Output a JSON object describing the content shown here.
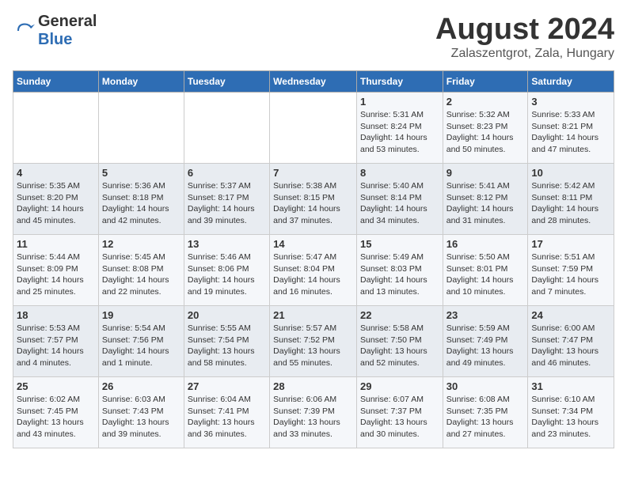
{
  "logo": {
    "line1": "General",
    "line2": "Blue"
  },
  "title": "August 2024",
  "subtitle": "Zalaszentgrot, Zala, Hungary",
  "days_of_week": [
    "Sunday",
    "Monday",
    "Tuesday",
    "Wednesday",
    "Thursday",
    "Friday",
    "Saturday"
  ],
  "weeks": [
    [
      {
        "day": "",
        "info": ""
      },
      {
        "day": "",
        "info": ""
      },
      {
        "day": "",
        "info": ""
      },
      {
        "day": "",
        "info": ""
      },
      {
        "day": "1",
        "info": "Sunrise: 5:31 AM\nSunset: 8:24 PM\nDaylight: 14 hours\nand 53 minutes."
      },
      {
        "day": "2",
        "info": "Sunrise: 5:32 AM\nSunset: 8:23 PM\nDaylight: 14 hours\nand 50 minutes."
      },
      {
        "day": "3",
        "info": "Sunrise: 5:33 AM\nSunset: 8:21 PM\nDaylight: 14 hours\nand 47 minutes."
      }
    ],
    [
      {
        "day": "4",
        "info": "Sunrise: 5:35 AM\nSunset: 8:20 PM\nDaylight: 14 hours\nand 45 minutes."
      },
      {
        "day": "5",
        "info": "Sunrise: 5:36 AM\nSunset: 8:18 PM\nDaylight: 14 hours\nand 42 minutes."
      },
      {
        "day": "6",
        "info": "Sunrise: 5:37 AM\nSunset: 8:17 PM\nDaylight: 14 hours\nand 39 minutes."
      },
      {
        "day": "7",
        "info": "Sunrise: 5:38 AM\nSunset: 8:15 PM\nDaylight: 14 hours\nand 37 minutes."
      },
      {
        "day": "8",
        "info": "Sunrise: 5:40 AM\nSunset: 8:14 PM\nDaylight: 14 hours\nand 34 minutes."
      },
      {
        "day": "9",
        "info": "Sunrise: 5:41 AM\nSunset: 8:12 PM\nDaylight: 14 hours\nand 31 minutes."
      },
      {
        "day": "10",
        "info": "Sunrise: 5:42 AM\nSunset: 8:11 PM\nDaylight: 14 hours\nand 28 minutes."
      }
    ],
    [
      {
        "day": "11",
        "info": "Sunrise: 5:44 AM\nSunset: 8:09 PM\nDaylight: 14 hours\nand 25 minutes."
      },
      {
        "day": "12",
        "info": "Sunrise: 5:45 AM\nSunset: 8:08 PM\nDaylight: 14 hours\nand 22 minutes."
      },
      {
        "day": "13",
        "info": "Sunrise: 5:46 AM\nSunset: 8:06 PM\nDaylight: 14 hours\nand 19 minutes."
      },
      {
        "day": "14",
        "info": "Sunrise: 5:47 AM\nSunset: 8:04 PM\nDaylight: 14 hours\nand 16 minutes."
      },
      {
        "day": "15",
        "info": "Sunrise: 5:49 AM\nSunset: 8:03 PM\nDaylight: 14 hours\nand 13 minutes."
      },
      {
        "day": "16",
        "info": "Sunrise: 5:50 AM\nSunset: 8:01 PM\nDaylight: 14 hours\nand 10 minutes."
      },
      {
        "day": "17",
        "info": "Sunrise: 5:51 AM\nSunset: 7:59 PM\nDaylight: 14 hours\nand 7 minutes."
      }
    ],
    [
      {
        "day": "18",
        "info": "Sunrise: 5:53 AM\nSunset: 7:57 PM\nDaylight: 14 hours\nand 4 minutes."
      },
      {
        "day": "19",
        "info": "Sunrise: 5:54 AM\nSunset: 7:56 PM\nDaylight: 14 hours\nand 1 minute."
      },
      {
        "day": "20",
        "info": "Sunrise: 5:55 AM\nSunset: 7:54 PM\nDaylight: 13 hours\nand 58 minutes."
      },
      {
        "day": "21",
        "info": "Sunrise: 5:57 AM\nSunset: 7:52 PM\nDaylight: 13 hours\nand 55 minutes."
      },
      {
        "day": "22",
        "info": "Sunrise: 5:58 AM\nSunset: 7:50 PM\nDaylight: 13 hours\nand 52 minutes."
      },
      {
        "day": "23",
        "info": "Sunrise: 5:59 AM\nSunset: 7:49 PM\nDaylight: 13 hours\nand 49 minutes."
      },
      {
        "day": "24",
        "info": "Sunrise: 6:00 AM\nSunset: 7:47 PM\nDaylight: 13 hours\nand 46 minutes."
      }
    ],
    [
      {
        "day": "25",
        "info": "Sunrise: 6:02 AM\nSunset: 7:45 PM\nDaylight: 13 hours\nand 43 minutes."
      },
      {
        "day": "26",
        "info": "Sunrise: 6:03 AM\nSunset: 7:43 PM\nDaylight: 13 hours\nand 39 minutes."
      },
      {
        "day": "27",
        "info": "Sunrise: 6:04 AM\nSunset: 7:41 PM\nDaylight: 13 hours\nand 36 minutes."
      },
      {
        "day": "28",
        "info": "Sunrise: 6:06 AM\nSunset: 7:39 PM\nDaylight: 13 hours\nand 33 minutes."
      },
      {
        "day": "29",
        "info": "Sunrise: 6:07 AM\nSunset: 7:37 PM\nDaylight: 13 hours\nand 30 minutes."
      },
      {
        "day": "30",
        "info": "Sunrise: 6:08 AM\nSunset: 7:35 PM\nDaylight: 13 hours\nand 27 minutes."
      },
      {
        "day": "31",
        "info": "Sunrise: 6:10 AM\nSunset: 7:34 PM\nDaylight: 13 hours\nand 23 minutes."
      }
    ]
  ]
}
